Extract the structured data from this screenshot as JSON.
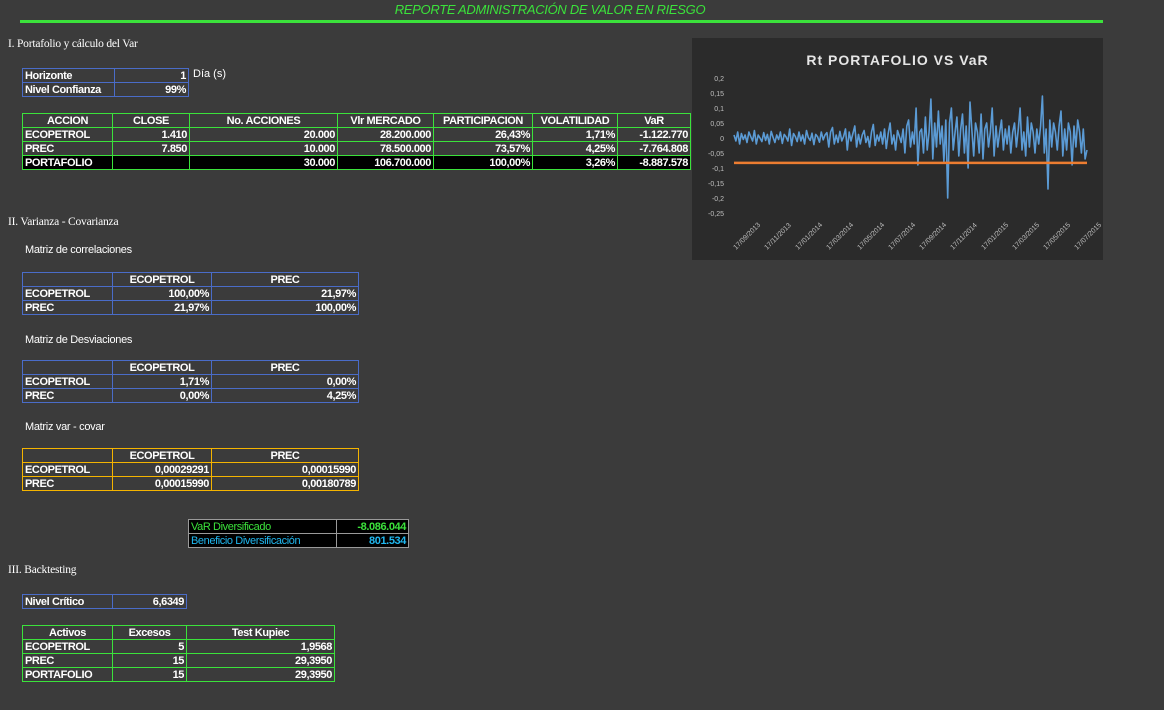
{
  "header": {
    "title": "REPORTE ADMINISTRACIÓN DE VALOR EN RIESGO"
  },
  "section1": {
    "heading": "I.  Portafolio y cálculo del Var",
    "horizonte_label": "Horizonte",
    "horizonte_value": "1",
    "horizonte_unit": "Día (s)",
    "confianza_label": "Nivel Confianza",
    "confianza_value": "99%",
    "table": {
      "headers": [
        "ACCION",
        "CLOSE",
        "No. ACCIONES",
        "Vlr MERCADO",
        "PARTICIPACION",
        "VOLATILIDAD",
        "VaR"
      ],
      "rows": [
        [
          "ECOPETROL",
          "1.410",
          "20.000",
          "28.200.000",
          "26,43%",
          "1,71%",
          "-1.122.770"
        ],
        [
          "PREC",
          "7.850",
          "10.000",
          "78.500.000",
          "73,57%",
          "4,25%",
          "-7.764.808"
        ],
        [
          "PORTAFOLIO",
          "",
          "30.000",
          "106.700.000",
          "100,00%",
          "3,26%",
          "-8.887.578"
        ]
      ]
    }
  },
  "section2": {
    "heading": "II.  Varianza - Covarianza",
    "corr": {
      "title": "Matriz de correlaciones",
      "headers": [
        "",
        "ECOPETROL",
        "PREC"
      ],
      "rows": [
        [
          "ECOPETROL",
          "100,00%",
          "21,97%"
        ],
        [
          "PREC",
          "21,97%",
          "100,00%"
        ]
      ]
    },
    "desv": {
      "title": "Matriz de Desviaciones",
      "headers": [
        "",
        "ECOPETROL",
        "PREC"
      ],
      "rows": [
        [
          "ECOPETROL",
          "1,71%",
          "0,00%"
        ],
        [
          "PREC",
          "0,00%",
          "4,25%"
        ]
      ]
    },
    "varcovar": {
      "title": "Matriz var - covar",
      "headers": [
        "",
        "ECOPETROL",
        "PREC"
      ],
      "rows": [
        [
          "ECOPETROL",
          "0,00029291",
          "0,00015990"
        ],
        [
          "PREC",
          "0,00015990",
          "0,00180789"
        ]
      ]
    },
    "div": {
      "var_label": "VaR Diversificado",
      "var_value": "-8.086.044",
      "ben_label": "Beneficio Diversificación",
      "ben_value": "801.534"
    }
  },
  "section3": {
    "heading": "III.  Backtesting",
    "nivel_label": "Nivel Crítico",
    "nivel_value": "6,6349",
    "table": {
      "headers": [
        "Activos",
        "Excesos",
        "Test Kupiec"
      ],
      "rows": [
        [
          "ECOPETROL",
          "5",
          "1,9568"
        ],
        [
          "PREC",
          "15",
          "29,3950"
        ],
        [
          "PORTAFOLIO",
          "15",
          "29,3950"
        ]
      ]
    }
  },
  "colors": {
    "background": "#3b3b3b",
    "accent_green": "#3be23b",
    "blue_border": "#4a6cc8",
    "yellow_border": "#f5b400",
    "chart_line": "#5b9bd5",
    "var_line": "#ed7d31",
    "cyan_text": "#20b8f0"
  },
  "chart_data": {
    "type": "line",
    "title": "Rt PORTAFOLIO VS VaR",
    "yticks": [
      "0,2",
      "0,15",
      "0,1",
      "0,05",
      "0",
      "-0,05",
      "-0,1",
      "-0,15",
      "-0,2",
      "-0,25"
    ],
    "ylim": [
      -0.25,
      0.2
    ],
    "xticks": [
      "17/09/2013",
      "17/11/2013",
      "17/01/2014",
      "17/03/2014",
      "17/05/2014",
      "17/07/2014",
      "17/09/2014",
      "17/11/2014",
      "17/01/2015",
      "17/03/2015",
      "17/05/2015",
      "17/07/2015"
    ],
    "var_level": -0.083,
    "series": [
      {
        "values": [
          0.01,
          -0.01,
          0.02,
          -0.02,
          0.015,
          -0.005,
          0.01,
          -0.015,
          0.02,
          0.005,
          -0.01,
          0.025,
          -0.02,
          0.01,
          0.0,
          -0.012,
          0.018,
          -0.008,
          0.012,
          -0.02,
          0.022,
          0.003,
          -0.015,
          0.01,
          -0.005,
          0.02,
          -0.018,
          0.012,
          0.004,
          -0.01,
          0.03,
          -0.025,
          0.015,
          0.005,
          -0.012,
          0.02,
          -0.01,
          0.01,
          -0.02,
          0.025,
          0.002,
          -0.008,
          0.016,
          -0.022,
          0.012,
          0.004,
          -0.014,
          0.02,
          -0.006,
          0.01,
          0.018,
          -0.03,
          0.02,
          0.035,
          -0.02,
          0.01,
          -0.015,
          0.022,
          -0.01,
          0.005,
          0.03,
          -0.04,
          0.02,
          -0.01,
          0.015,
          0.04,
          -0.03,
          0.012,
          -0.02,
          0.01,
          0.025,
          -0.015,
          0.005,
          -0.03,
          0.02,
          0.045,
          -0.025,
          0.01,
          -0.01,
          0.02,
          -0.02,
          0.03,
          -0.035,
          0.015,
          0.05,
          -0.02,
          0.01,
          -0.04,
          0.025,
          0.005,
          -0.015,
          0.03,
          -0.05,
          0.04,
          0.06,
          -0.03,
          0.02,
          -0.02,
          0.1,
          -0.09,
          0.02,
          0.03,
          -0.05,
          0.07,
          -0.04,
          0.02,
          0.13,
          -0.07,
          0.05,
          -0.03,
          0.09,
          -0.02,
          0.04,
          -0.08,
          0.06,
          -0.2,
          0.05,
          0.1,
          -0.04,
          0.02,
          0.07,
          -0.06,
          0.03,
          0.08,
          -0.05,
          0.04,
          -0.1,
          0.12,
          0.03,
          -0.06,
          0.05,
          0.02,
          -0.05,
          0.08,
          -0.07,
          0.03,
          0.05,
          -0.03,
          0.02,
          0.1,
          -0.06,
          0.04,
          -0.03,
          0.02,
          0.06,
          -0.04,
          0.03,
          -0.02,
          0.04,
          -0.05,
          0.02,
          0.05,
          -0.03,
          0.03,
          0.1,
          -0.04,
          0.02,
          -0.06,
          0.07,
          -0.03,
          0.05,
          0.02,
          -0.05,
          0.03,
          -0.02,
          0.04,
          0.14,
          -0.05,
          0.03,
          -0.17,
          0.06,
          -0.03,
          0.05,
          0.02,
          -0.04,
          0.04,
          0.09,
          -0.06,
          0.03,
          -0.04,
          0.05,
          0.02,
          -0.09,
          0.04,
          -0.03,
          0.06,
          0.02,
          -0.05,
          0.03,
          -0.07,
          -0.04
        ]
      }
    ]
  }
}
